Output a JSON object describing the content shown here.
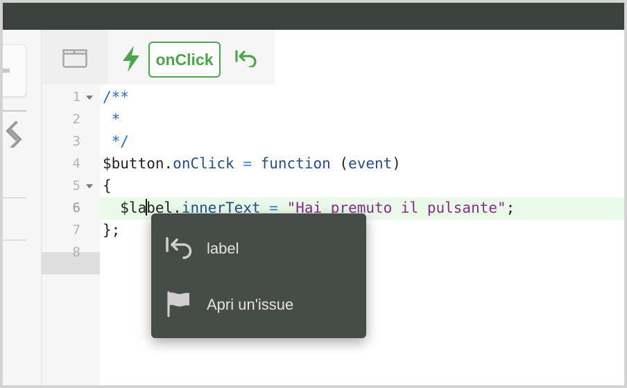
{
  "toolbar": {
    "event_badge": "onClick",
    "icons": [
      "panels-icon",
      "bolt-icon",
      "undo-icon"
    ],
    "accent_color": "#4ba64b"
  },
  "code": {
    "line_numbers": [
      "1",
      "2",
      "3",
      "4",
      "5",
      "6",
      "7",
      "8"
    ],
    "foldable_lines": [
      "1",
      "5"
    ],
    "active_line": "6",
    "line1": "/**",
    "line2": " *",
    "line3": " */",
    "line4_var": "$button",
    "line4_dot": ".",
    "line4_prop": "onClick",
    "line4_eq": " = ",
    "line4_kw": "function",
    "line4_open": " (",
    "line4_param": "event",
    "line4_close": ")",
    "line5": "{",
    "line6_indent": "  ",
    "line6_var_a": "$la",
    "line6_var_b": "bel",
    "line6_dot": ".",
    "line6_prop": "innerText",
    "line6_eq": " = ",
    "line6_str": "\"Hai premuto il pulsante\"",
    "line6_end": ";",
    "line7": "};",
    "line8": ""
  },
  "popup": {
    "items": [
      {
        "icon": "undo-icon",
        "label": "label"
      },
      {
        "icon": "flag-icon",
        "label": "Apri un'issue"
      }
    ]
  }
}
